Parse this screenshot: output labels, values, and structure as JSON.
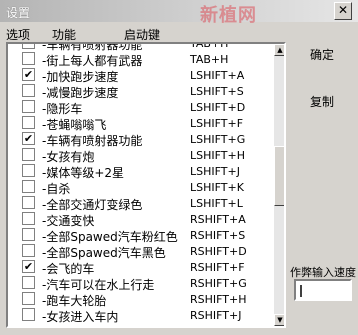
{
  "window": {
    "title": "设置",
    "watermark": "新植网",
    "close_label": "✕"
  },
  "menu": {
    "options": "选项",
    "function": "功能",
    "hotkey": "启动键"
  },
  "cheats": [
    {
      "label": "-车辆有喷射器功能",
      "key": "TAB+H",
      "checked": false,
      "partial": true
    },
    {
      "label": "-街上每人都有武器",
      "key": "TAB+H",
      "checked": false
    },
    {
      "label": "-加快跑步速度",
      "key": "LSHIFT+A",
      "checked": true
    },
    {
      "label": "-减慢跑步速度",
      "key": "LSHIFT+S",
      "checked": false
    },
    {
      "label": "-隐形车",
      "key": "LSHIFT+D",
      "checked": false
    },
    {
      "label": "-苍蝇嗡嗡飞",
      "key": "LSHIFT+F",
      "checked": false
    },
    {
      "label": "-车辆有喷射器功能",
      "key": "LSHIFT+G",
      "checked": true
    },
    {
      "label": "-女孩有炮",
      "key": "LSHIFT+H",
      "checked": false
    },
    {
      "label": "-媒体等级+2星",
      "key": "LSHIFT+J",
      "checked": false
    },
    {
      "label": "-自杀",
      "key": "LSHIFT+K",
      "checked": false
    },
    {
      "label": "-全部交通灯变绿色",
      "key": "LSHIFT+L",
      "checked": false
    },
    {
      "label": "-交通变快",
      "key": "RSHIFT+A",
      "checked": false
    },
    {
      "label": "-全部Spawed汽车粉红色",
      "key": "RSHIFT+S",
      "checked": false
    },
    {
      "label": "-全部Spawed汽车黑色",
      "key": "RSHIFT+D",
      "checked": false
    },
    {
      "label": "-会飞的车",
      "key": "RSHIFT+F",
      "checked": true
    },
    {
      "label": "-汽车可以在水上行走",
      "key": "RSHIFT+G",
      "checked": false
    },
    {
      "label": "-跑车大轮胎",
      "key": "RSHIFT+H",
      "checked": false
    },
    {
      "label": "-女孩进入车内",
      "key": "RSHIFT+J",
      "checked": false,
      "partial": true
    }
  ],
  "buttons": {
    "ok": "确定",
    "copy": "复制"
  },
  "speed": {
    "label": "作弊输入速度"
  },
  "colors": {
    "background": "#d6d3ce",
    "list_bg": "#ffffff",
    "watermark": "#dc505a"
  }
}
